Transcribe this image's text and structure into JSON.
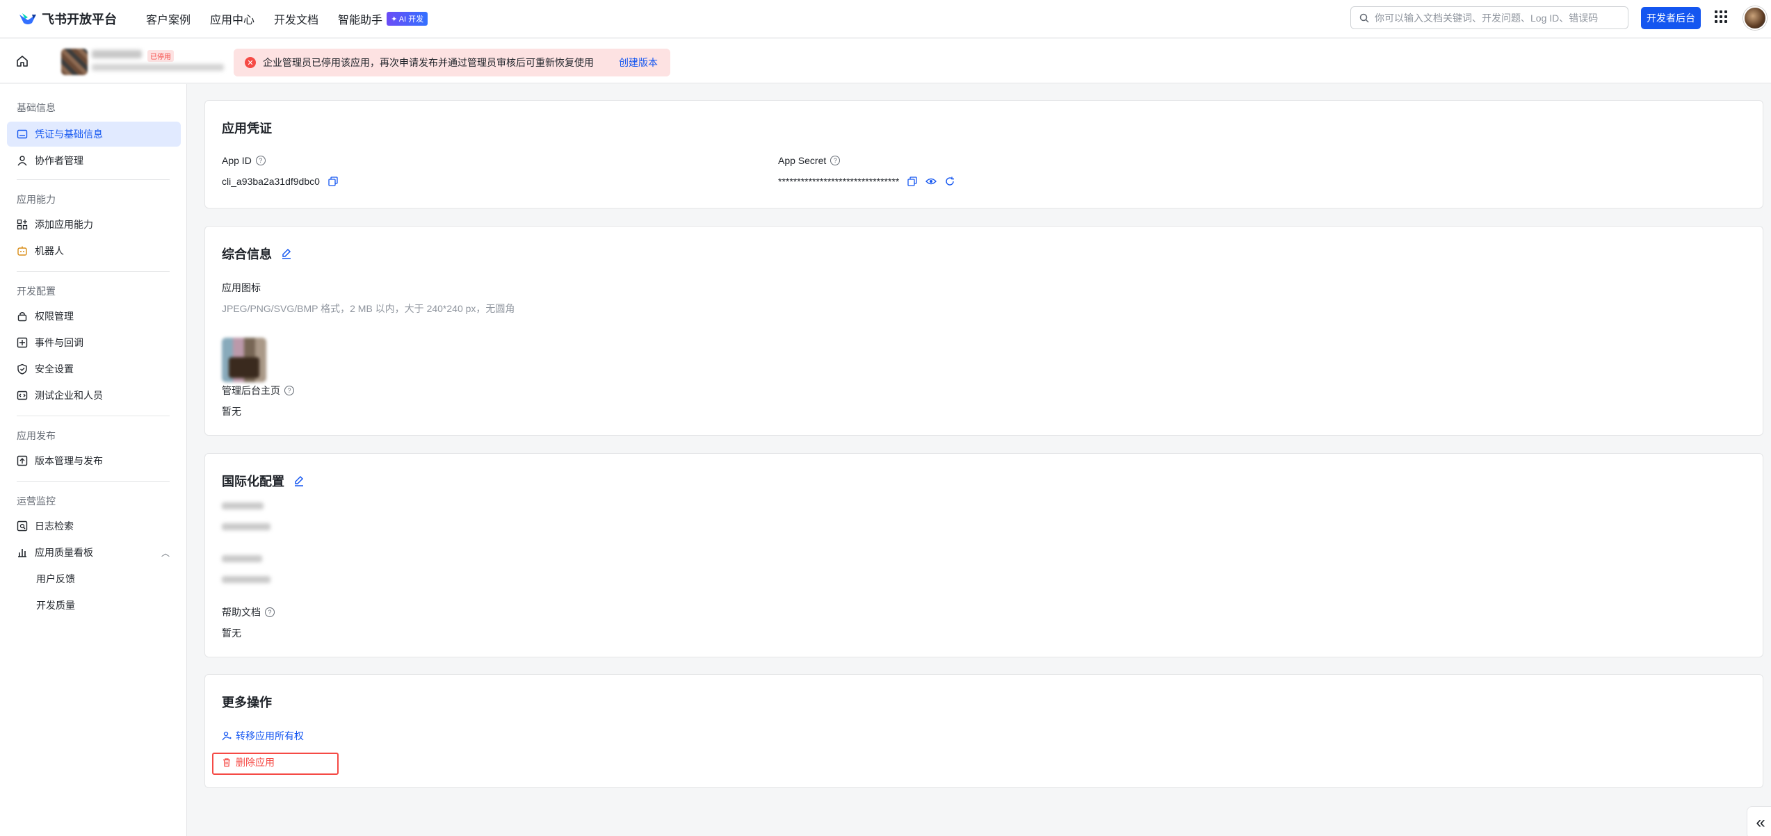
{
  "topnav": {
    "brand": "飞书开放平台",
    "items": [
      "客户案例",
      "应用中心",
      "开发文档",
      "智能助手"
    ],
    "ai_badge": "✦ AI 开发",
    "search_placeholder": "你可以输入文档关键词、开发问题、Log ID、错误码",
    "dev_console": "开发者后台"
  },
  "subhead": {
    "status_tag": "已停用",
    "alert_text": "企业管理员已停用该应用，再次申请发布并通过管理员审核后可重新恢复使用",
    "alert_link": "创建版本"
  },
  "sidebar": {
    "sections": [
      {
        "title": "基础信息",
        "items": [
          "凭证与基础信息",
          "协作者管理"
        ]
      },
      {
        "title": "应用能力",
        "items": [
          "添加应用能力",
          "机器人"
        ]
      },
      {
        "title": "开发配置",
        "items": [
          "权限管理",
          "事件与回调",
          "安全设置",
          "测试企业和人员"
        ]
      },
      {
        "title": "应用发布",
        "items": [
          "版本管理与发布"
        ]
      },
      {
        "title": "运营监控",
        "items": [
          "日志检索",
          "应用质量看板",
          "用户反馈",
          "开发质量"
        ]
      }
    ]
  },
  "credentials": {
    "title": "应用凭证",
    "app_id_label": "App ID",
    "app_id": "cli_a93ba2a31df9dbc0",
    "app_secret_label": "App Secret",
    "app_secret": "********************************"
  },
  "general": {
    "title": "综合信息",
    "icon_label": "应用图标",
    "icon_hint": "JPEG/PNG/SVG/BMP 格式，2 MB 以内，大于 240*240 px，无圆角",
    "admin_home_label": "管理后台主页",
    "admin_home_value": "暂无"
  },
  "i18n": {
    "title": "国际化配置",
    "help_doc_label": "帮助文档",
    "help_doc_value": "暂无"
  },
  "more": {
    "title": "更多操作",
    "transfer": "转移应用所有权",
    "delete": "删除应用"
  },
  "colors": {
    "accent": "#1456f0",
    "danger": "#f54a45",
    "active_bg": "#e1eaff"
  }
}
